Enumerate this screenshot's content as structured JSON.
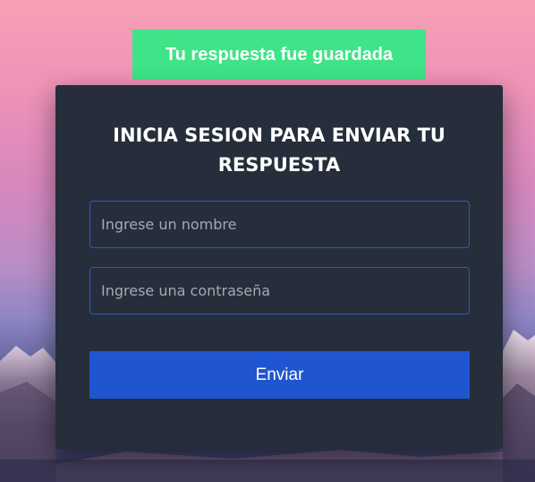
{
  "toast": {
    "message": "Tu respuesta fue guardada",
    "color": "#3fe488"
  },
  "form": {
    "title": "INICIA SESION PARA ENVIAR TU RESPUESTA",
    "name_placeholder": "Ingrese un nombre",
    "password_placeholder": "Ingrese una contraseña",
    "submit_label": "Enviar",
    "card_color": "#252e3a",
    "accent_color": "#1f55d0"
  }
}
